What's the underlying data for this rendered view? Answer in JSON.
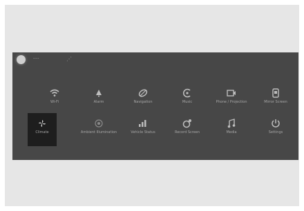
{
  "status_bar": {
    "left_text": "---",
    "icon": "cell-signal-icon"
  },
  "apps": [
    {
      "label": "Wi-Fi",
      "icon": "wifi-icon"
    },
    {
      "label": "Alarm",
      "icon": "bell-icon"
    },
    {
      "label": "Navigation",
      "icon": "compass-icon"
    },
    {
      "label": "Music",
      "icon": "music-icon"
    },
    {
      "label": "Phone / Projection",
      "icon": "projection-icon"
    },
    {
      "label": "Mirror Screen",
      "icon": "mirror-icon"
    },
    {
      "label": "Climate",
      "icon": "fan-icon"
    },
    {
      "label": "Ambient Illumination",
      "icon": "light-icon"
    },
    {
      "label": "Vehicle Status",
      "icon": "gauge-icon"
    },
    {
      "label": "Record Screen",
      "icon": "record-icon"
    },
    {
      "label": "Media",
      "icon": "media-icon"
    },
    {
      "label": "Settings",
      "icon": "gear-icon"
    }
  ],
  "selected_index": 6
}
